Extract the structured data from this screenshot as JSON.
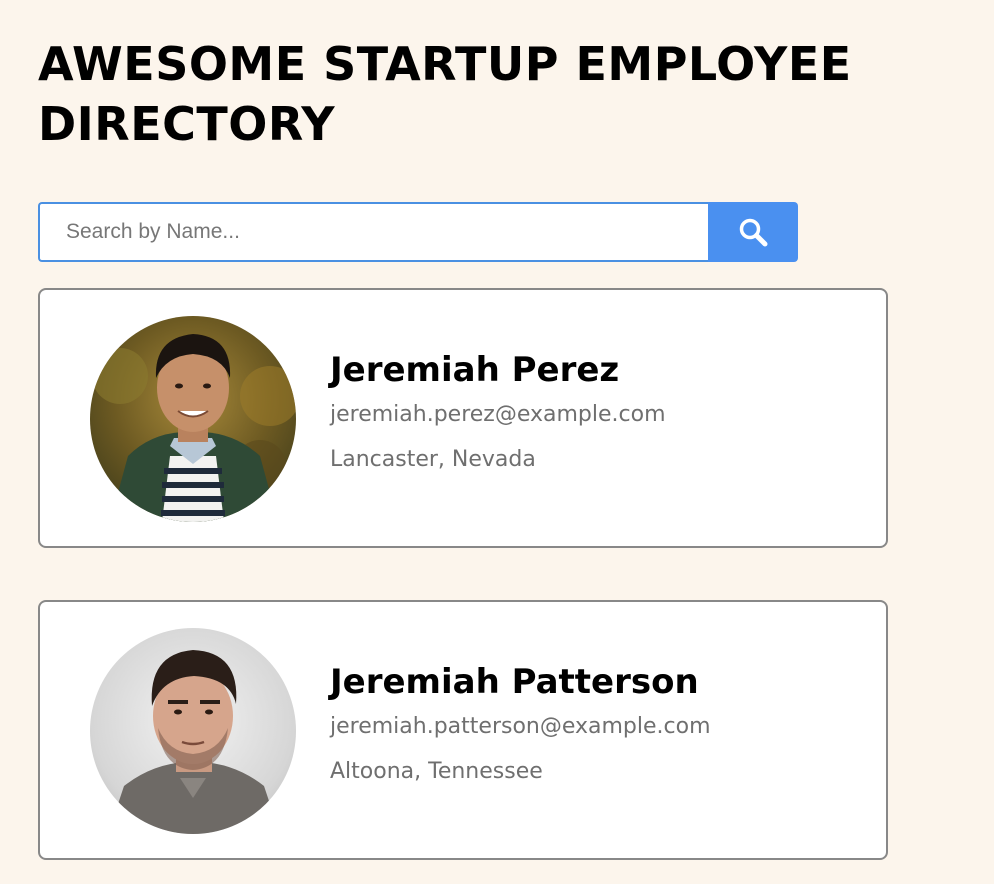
{
  "header": {
    "title": "AWESOME STARTUP EMPLOYEE DIRECTORY"
  },
  "search": {
    "placeholder": "Search by Name...",
    "value": "",
    "button_icon": "search-icon"
  },
  "employees": [
    {
      "name": "Jeremiah Perez",
      "email": "jeremiah.perez@example.com",
      "location": "Lancaster, Nevada"
    },
    {
      "name": "Jeremiah Patterson",
      "email": "jeremiah.patterson@example.com",
      "location": "Altoona, Tennessee"
    }
  ],
  "colors": {
    "background": "#fcf5ec",
    "accent": "#4a90f0",
    "card_border": "#888888",
    "secondary_text": "#6f6f6f"
  }
}
